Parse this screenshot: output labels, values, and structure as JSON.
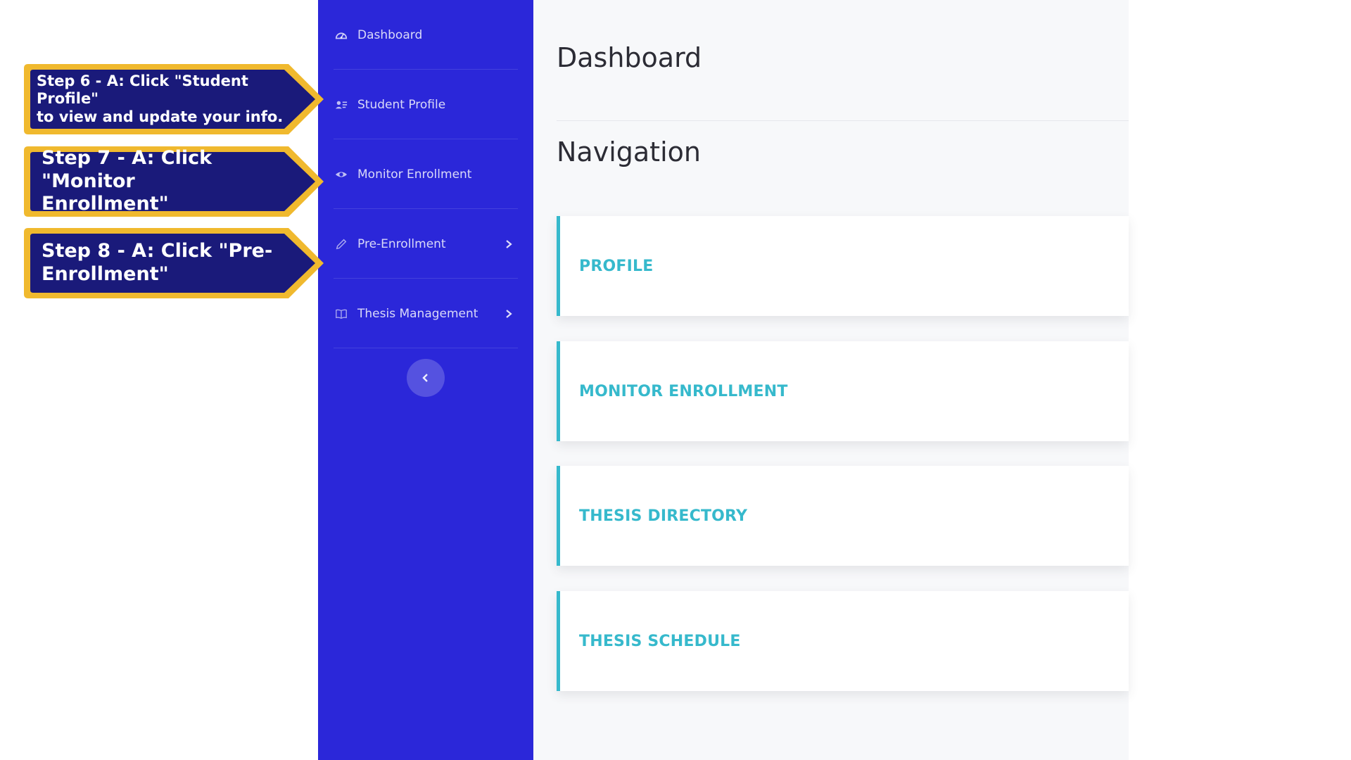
{
  "sidebar": {
    "items": [
      {
        "label": "Dashboard",
        "icon": "gauge-icon"
      },
      {
        "label": "Student Profile",
        "icon": "user-list-icon"
      },
      {
        "label": "Monitor Enrollment",
        "icon": "eye-icon"
      },
      {
        "label": "Pre-Enrollment",
        "icon": "pencil-icon",
        "has_submenu": true
      },
      {
        "label": "Thesis Management",
        "icon": "book-icon",
        "has_submenu": true
      }
    ],
    "collapse_icon": "chevron-left-icon"
  },
  "main": {
    "page_title": "Dashboard",
    "section_title": "Navigation",
    "cards": [
      {
        "label": "PROFILE"
      },
      {
        "label": "MONITOR ENROLLMENT"
      },
      {
        "label": "THESIS DIRECTORY"
      },
      {
        "label": "THESIS SCHEDULE"
      }
    ]
  },
  "callouts": [
    {
      "line1": "Step 6 - A: Click \"Student Profile\"",
      "line2": "to view and update your info."
    },
    {
      "line1": "Step 7 - A: Click \"Monitor",
      "line2": "Enrollment\""
    },
    {
      "line1": "Step 8 - A: Click \"Pre-",
      "line2": "Enrollment\""
    }
  ],
  "colors": {
    "sidebar_bg": "#2b27d9",
    "card_accent": "#36b9cc",
    "callout_fill": "#1a1a7a",
    "callout_border": "#f0b92e"
  }
}
